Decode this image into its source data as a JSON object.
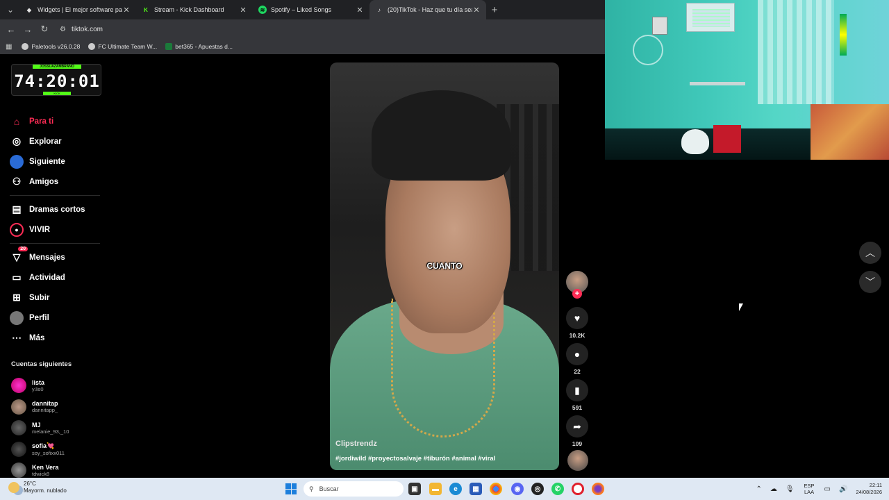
{
  "browser": {
    "tabs": [
      {
        "title": "Widgets | El mejor software pa",
        "icon": "widget-icon",
        "color": "#ffffff"
      },
      {
        "title": "Stream - Kick Dashboard",
        "icon": "kick-icon",
        "color": "#53fc18"
      },
      {
        "title": "Spotify – Liked Songs",
        "icon": "spotify-icon",
        "color": "#1ed760"
      },
      {
        "title": "(20)TikTok - Haz que tu día sea",
        "icon": "tiktok-icon",
        "color": "#ffffff"
      }
    ],
    "new_tab": "+",
    "url": "tiktok.com",
    "bookmarks": [
      "Paletools v26.0.28",
      "FC Ultimate Team W...",
      "bet365 - Apuestas d..."
    ]
  },
  "timer": {
    "top_label": "JOSSUAZAMBRANO",
    "value": "74:20:01",
    "bottom_label": "KICK"
  },
  "sidebar": {
    "items": [
      {
        "label": "Para ti",
        "icon": "home-icon",
        "active": true
      },
      {
        "label": "Explorar",
        "icon": "compass-icon"
      },
      {
        "label": "Siguiente",
        "icon": "following-icon"
      },
      {
        "label": "Amigos",
        "icon": "friends-icon"
      },
      {
        "label": "Dramas cortos",
        "icon": "film-icon"
      },
      {
        "label": "VIVIR",
        "icon": "live-icon"
      },
      {
        "label": "Mensajes",
        "icon": "messages-icon",
        "badge": "20"
      },
      {
        "label": "Actividad",
        "icon": "activity-icon"
      },
      {
        "label": "Subir",
        "icon": "upload-icon"
      },
      {
        "label": "Perfil",
        "icon": "profile-icon"
      },
      {
        "label": "Más",
        "icon": "more-icon"
      }
    ],
    "following_title": "Cuentas siguientes",
    "following": [
      {
        "name": "lista",
        "handle": "y.lis0"
      },
      {
        "name": "dannitap",
        "handle": "dannitapp_"
      },
      {
        "name": "MJ",
        "handle": "melanie_93,_10"
      },
      {
        "name": "sofia💘",
        "handle": "soy_sofixx011"
      },
      {
        "name": "Ken Vera",
        "handle": "tdwick8"
      }
    ]
  },
  "video": {
    "caption_word": "CUANTO",
    "author": "Clipstrendz",
    "hashtags": "#jordiwild #proyectosalvaje #tiburón #animal #viral"
  },
  "actions": {
    "likes": "10.2K",
    "comments": "22",
    "saves": "591",
    "shares": "109"
  },
  "taskbar": {
    "temperature": "26°C",
    "weather": "Mayorm. nublado",
    "search_placeholder": "Buscar",
    "lang_top": "ESP",
    "lang_bottom": "LAA",
    "time": "22:11",
    "date": "24/08/2026"
  },
  "colors": {
    "accent": "#fe2c55",
    "kick_green": "#53fc18"
  }
}
